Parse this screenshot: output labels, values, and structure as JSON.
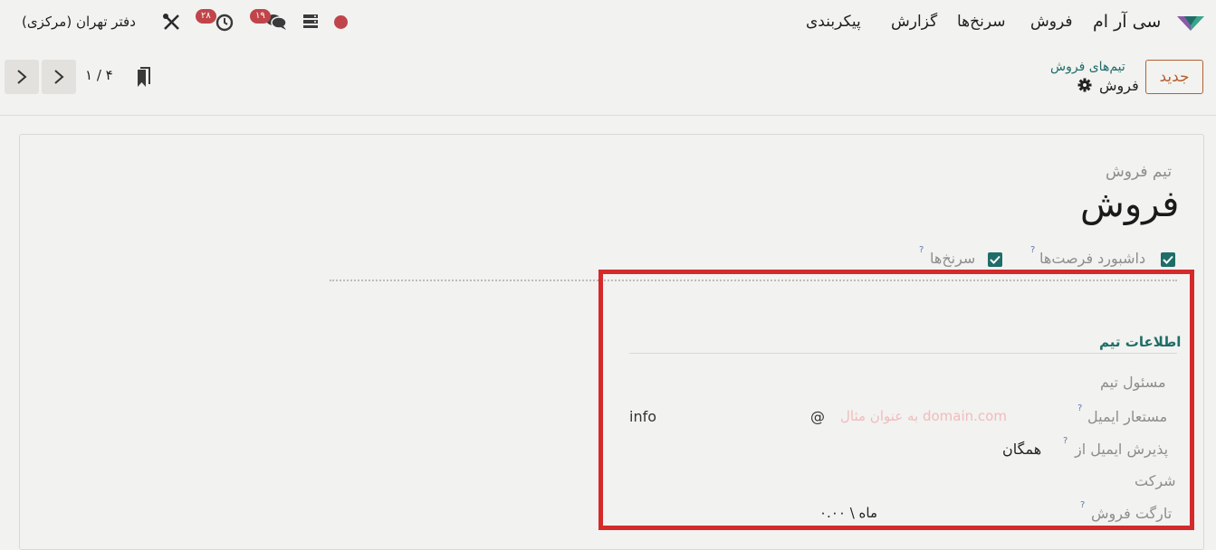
{
  "navbar": {
    "app_name": "سی آر ام",
    "menu": [
      "فروش",
      "سرنخ‌ها",
      "گزارش",
      "پیکربندی"
    ],
    "company": "دفتر تهران (مرکزی)",
    "activity_count": "۲۸",
    "messages_count": "۱۹",
    "status_color": "#c0454a"
  },
  "control_panel": {
    "new_label": "جدید",
    "breadcrumb_parent": "تیم‌های فروش",
    "breadcrumb_current": "فروش",
    "pager": "۱ / ۴"
  },
  "form": {
    "subtitle": "تیم فروش",
    "title": "فروش",
    "options": [
      {
        "label": "داشبورد فرصت‌ها",
        "checked": true
      },
      {
        "label": "سرنخ‌ها",
        "checked": true
      }
    ],
    "section_title": "اطلاعات تیم",
    "fields": {
      "leader_label": "مسئول تیم",
      "alias_label": "مستعار ایمیل",
      "alias_placeholder": "به عنوان مثال domain.com",
      "alias_at": "@",
      "alias_value": "info",
      "accept_label": "پذیرش ایمیل از",
      "accept_value": "همگان",
      "company_label": "شرکت",
      "target_label": "تارگت فروش",
      "target_value": "۰.۰۰ \\ ماه"
    }
  },
  "colors": {
    "accent": "#1f6d68",
    "brand_button": "#b5602e",
    "highlight_box": "#d42a2a",
    "badge": "#c0454a"
  }
}
